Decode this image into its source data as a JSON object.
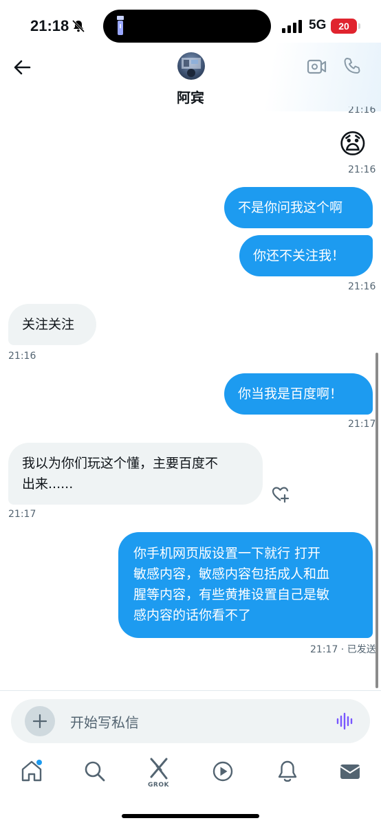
{
  "status_bar": {
    "time": "21:18",
    "network": "5G",
    "battery": "20"
  },
  "header": {
    "contact_name": "阿宾"
  },
  "messages": [
    {
      "type": "timestamp_partial",
      "time": "21:16"
    },
    {
      "type": "emoji",
      "text": "😧",
      "time": "21:16"
    },
    {
      "type": "outgoing",
      "text": "不是你问我这个啊"
    },
    {
      "type": "outgoing",
      "text": "你还不关注我！",
      "time": "21:16"
    },
    {
      "type": "incoming",
      "text": "关注关注",
      "time": "21:16"
    },
    {
      "type": "outgoing",
      "text": "你当我是百度啊！",
      "time": "21:17"
    },
    {
      "type": "incoming",
      "lines": [
        "我以为你们玩这个懂，主要百度不",
        "出来......"
      ],
      "time": "21:17"
    },
    {
      "type": "outgoing",
      "lines": [
        "你手机网页版设置一下就行 打开",
        "敏感内容，敏感内容包括成人和血",
        "腥等内容，有些黄推设置自己是敏",
        "感内容的话你看不了"
      ],
      "time": "21:17 · 已发送"
    }
  ],
  "composer": {
    "placeholder": "开始写私信"
  },
  "tabs": [
    {
      "name": "home",
      "label": ""
    },
    {
      "name": "search",
      "label": ""
    },
    {
      "name": "grok",
      "label": "GROK"
    },
    {
      "name": "video",
      "label": ""
    },
    {
      "name": "notifications",
      "label": ""
    },
    {
      "name": "messages",
      "label": ""
    }
  ],
  "colors": {
    "accent": "#1d9bf0",
    "incoming_bubble": "#eff3f4",
    "battery_low": "#e0242e"
  },
  "icons": [
    "bell-slash-icon",
    "flashlight-icon",
    "signal-icon",
    "back-arrow-icon",
    "video-call-icon",
    "phone-icon",
    "add-heart-icon",
    "plus-icon",
    "voice-icon",
    "home-icon",
    "search-icon",
    "grok-icon",
    "play-icon",
    "bell-icon",
    "mail-icon"
  ]
}
